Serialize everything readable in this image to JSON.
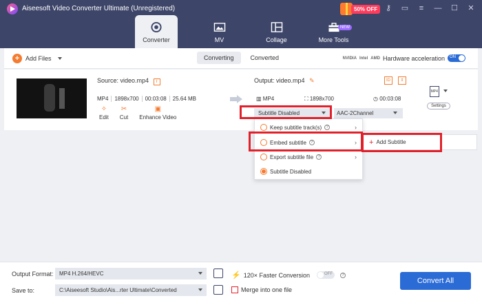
{
  "app": {
    "title": "Aiseesoft Video Converter Ultimate (Unregistered)",
    "promo": "50% OFF"
  },
  "nav": {
    "tabs": [
      {
        "label": "Converter"
      },
      {
        "label": "MV"
      },
      {
        "label": "Collage"
      },
      {
        "label": "More Tools",
        "badge": "NEW"
      }
    ]
  },
  "toolbar": {
    "add_files": "Add Files",
    "converting": "Converting",
    "converted": "Converted",
    "brands": [
      "NVIDIA",
      "Intel",
      "AMD"
    ],
    "hw_accel": "Hardware acceleration",
    "toggle": "ON"
  },
  "file": {
    "source": "Source: video.mp4",
    "format": "MP4",
    "resolution": "1898x700",
    "duration": "00:03:08",
    "size": "25.64 MB",
    "edit": "Edit",
    "cut": "Cut",
    "enhance": "Enhance Video",
    "output": "Output: video.mp4",
    "out_format": "MP4",
    "out_resolution": "1898x700",
    "out_duration": "00:03:08",
    "subtitle": "Subtitle Disabled",
    "audio": "AAC-2Channel",
    "settings": "Settings",
    "fmt_icon": "MP4"
  },
  "dropdown": {
    "items": [
      {
        "label": "Keep subtitle track(s)"
      },
      {
        "label": "Embed subtitle"
      },
      {
        "label": "Export subtitle file"
      },
      {
        "label": "Subtitle Disabled"
      }
    ],
    "submenu": "Add Subtitle"
  },
  "bottom": {
    "output_format_label": "Output Format:",
    "output_format": "MP4 H.264/HEVC",
    "save_to_label": "Save to:",
    "save_to": "C:\\Aiseesoft Studio\\Ais...rter Ultimate\\Converted",
    "faster": "120× Faster Conversion",
    "toggle": "OFF",
    "merge": "Merge into one file",
    "convert_all": "Convert All"
  },
  "colors": {
    "titlebar": "#3d4569",
    "accent": "#f47b2f",
    "primary": "#2b6bd6",
    "highlight": "#e0202a"
  }
}
